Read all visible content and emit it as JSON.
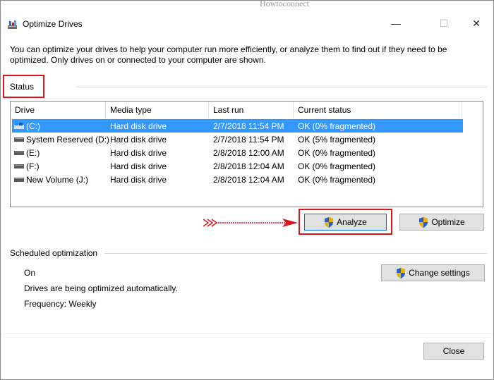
{
  "watermark": "Howtoconnect",
  "window": {
    "title": "Optimize Drives",
    "controls": {
      "minimize": "—",
      "maximize": "☐",
      "close": "✕"
    }
  },
  "description": "You can optimize your drives to help your computer run more efficiently, or analyze them to find out if they need to be optimized. Only drives on or connected to your computer are shown.",
  "status": {
    "label": "Status",
    "columns": [
      "Drive",
      "Media type",
      "Last run",
      "Current status"
    ],
    "rows": [
      {
        "drive": "(C:)",
        "media": "Hard disk drive",
        "last_run": "2/7/2018 11:54 PM",
        "status": "OK (0% fragmented)",
        "selected": true
      },
      {
        "drive": "System Reserved (D:)",
        "media": "Hard disk drive",
        "last_run": "2/7/2018 11:54 PM",
        "status": "OK (5% fragmented)",
        "selected": false
      },
      {
        "drive": "(E:)",
        "media": "Hard disk drive",
        "last_run": "2/8/2018 12:00 AM",
        "status": "OK (0% fragmented)",
        "selected": false
      },
      {
        "drive": "(F:)",
        "media": "Hard disk drive",
        "last_run": "2/8/2018 12:04 AM",
        "status": "OK (0% fragmented)",
        "selected": false
      },
      {
        "drive": "New Volume (J:)",
        "media": "Hard disk drive",
        "last_run": "2/8/2018 12:04 AM",
        "status": "OK (0% fragmented)",
        "selected": false
      }
    ]
  },
  "buttons": {
    "analyze": "Analyze",
    "optimize": "Optimize",
    "change_settings": "Change settings",
    "close": "Close"
  },
  "scheduled": {
    "label": "Scheduled optimization",
    "state": "On",
    "detail": "Drives are being optimized automatically.",
    "frequency": "Frequency: Weekly"
  },
  "colors": {
    "selection": "#3399ff",
    "annotation_red": "#d9151b"
  }
}
